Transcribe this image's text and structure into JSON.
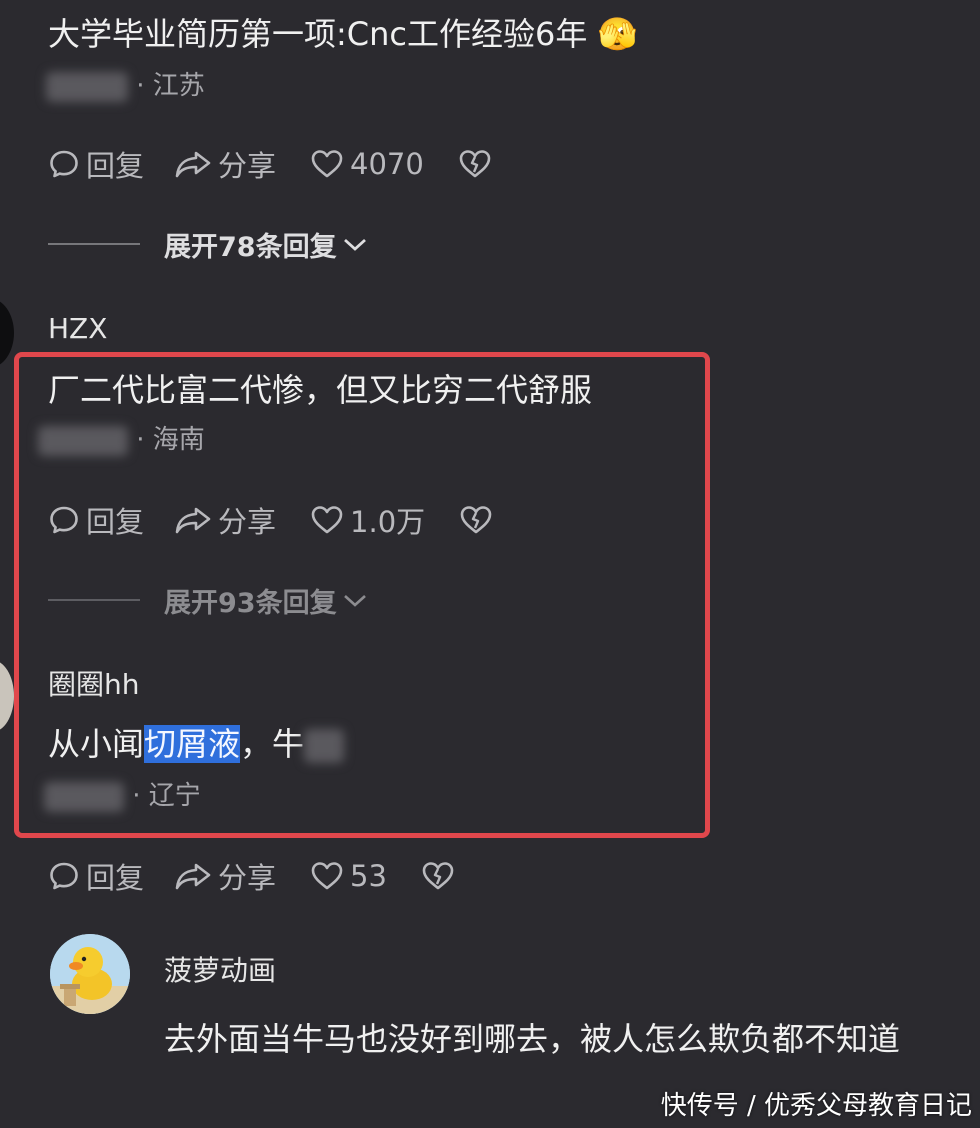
{
  "comments": [
    {
      "text": "大学毕业简历第一项:Cnc工作经验6年",
      "emoji": "🫣",
      "location": "· 江苏",
      "actions": {
        "reply": "回复",
        "share": "分享",
        "likes": "4070"
      },
      "expand_label": "展开78条回复"
    },
    {
      "username": "HZX",
      "text": "厂二代比富二代惨，但又比穷二代舒服",
      "location": "· 海南",
      "actions": {
        "reply": "回复",
        "share": "分享",
        "likes": "1.0万"
      },
      "expand_label": "展开93条回复"
    },
    {
      "username": "圈圈hh",
      "text_before": "从小闻",
      "text_selected": "切屑液",
      "text_after": "，牛",
      "location": "· 辽宁",
      "actions": {
        "reply": "回复",
        "share": "分享",
        "likes": "53"
      }
    },
    {
      "username": "菠萝动画",
      "text": "去外面当牛马也没好到哪去，被人怎么欺负都不知道"
    }
  ],
  "watermark": "快传号 / 优秀父母教育日记",
  "colors": {
    "background": "#2b2a2f",
    "highlight_border": "#e0474c",
    "selection": "#2f6fdc"
  },
  "icons": [
    "reply-icon",
    "share-icon",
    "like-heart-icon",
    "dislike-broken-heart-icon",
    "chevron-down-icon"
  ]
}
